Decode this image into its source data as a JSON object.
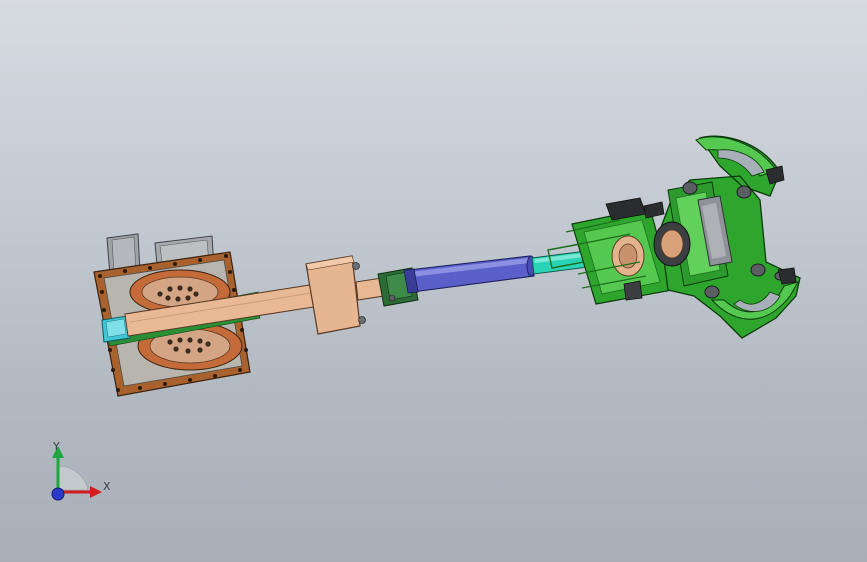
{
  "viewport": {
    "background_top": "#d6dbe0",
    "background_bottom": "#a7afb8"
  },
  "model": {
    "colors": {
      "base_plate": "#a9622e",
      "base_block": "#b9b6b0",
      "motor_housing": "#9da1a6",
      "turntable_ring": "#c46b39",
      "turntable_face": "#d2a383",
      "link": "#e8b894",
      "link_edge": "#5a3a24",
      "joint_cyan": "#3fc7d6",
      "cylinder_blue": "#5a5fc9",
      "rod_teal": "#2ad3b5",
      "gripper_green": "#2ea62e",
      "gripper_dark": "#1d6e1d",
      "gripper_light": "#54c84f",
      "knob": "#5b5f63"
    }
  },
  "triad": {
    "x_label": "X",
    "y_label": "Y",
    "x_color": "#d21e1e",
    "y_color": "#1fa63c",
    "z_color": "#2a3acb"
  }
}
